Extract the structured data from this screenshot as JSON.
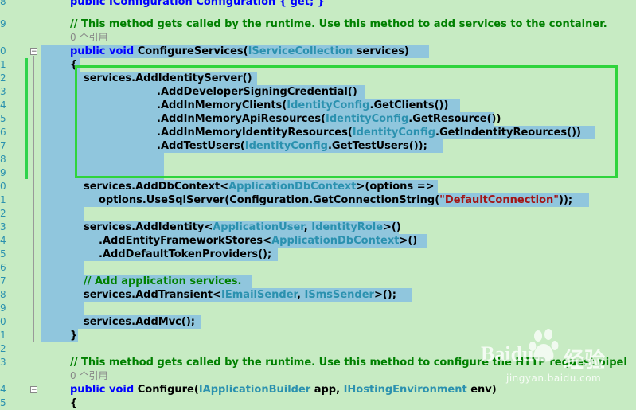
{
  "line_numbers": [
    "8",
    "9",
    "0",
    "1",
    "2",
    "3",
    "4",
    "5",
    "6",
    "7",
    "8",
    "9",
    "0",
    "1",
    "2",
    "3",
    "4",
    "5",
    "6",
    "7",
    "8",
    "9",
    "0",
    "1",
    "2",
    "3",
    "4",
    "5",
    "6"
  ],
  "code": {
    "top_partial": "public IConfiguration Configuration { get; }",
    "comment1": "// This method gets called by the runtime. Use this method to add services to the container.",
    "refs1": "0 个引用",
    "kw_public": "public",
    "kw_void": "void",
    "method1": "ConfigureServices(",
    "type_iservicecollection": "IServiceCollection",
    "param1": " services)",
    "brace_open": "{",
    "brace_close": "}",
    "is1": "services.AddIdentityServer()",
    "is2": ".AddDeveloperSigningCredential()",
    "is3a": ".AddInMemoryClients(",
    "is3t": "IdentityConfig",
    "is3b": ".GetClients())",
    "is4a": ".AddInMemoryApiResources(",
    "is4t": "IdentityConfig",
    "is4b": ".GetResource())",
    "is5a": ".AddInMemoryIdentityResources(",
    "is5t": "IdentityConfig",
    "is5b": ".GetIndentityReources())",
    "is6a": ".AddTestUsers(",
    "is6t": "IdentityConfig",
    "is6b": ".GetTestUsers());",
    "db1a": "services.AddDbContext<",
    "db1t": "ApplicationDbContext",
    "db1b": ">(options =>",
    "db2a": "options.UseSqlServer(Configuration.GetConnectionString(",
    "db2s": "\"DefaultConnection\"",
    "db2b": "));",
    "id1a": "services.AddIdentity<",
    "id1t1": "ApplicationUser",
    "id1c": ", ",
    "id1t2": "IdentityRole",
    "id1b": ">()",
    "id2a": ".AddEntityFrameworkStores<",
    "id2t": "ApplicationDbContext",
    "id2b": ">()",
    "id3": ".AddDefaultTokenProviders();",
    "comment2": "// Add application services.",
    "tr1a": "services.AddTransient<",
    "tr1t1": "IEmailSender",
    "tr1c": ", ",
    "tr1t2": "ISmsSender",
    "tr1b": ">();",
    "mvc": "services.AddMvc();",
    "comment3": "// This method gets called by the runtime. Use this method to configure the HTTP request pipel",
    "refs2": "0 个引用",
    "method2": "Configure(",
    "type_iapp": "IApplicationBuilder",
    "param2a": " app, ",
    "type_ienv": "IHostingEnvironment",
    "param2b": " env)",
    "brace_open2": "{"
  },
  "watermark": {
    "brand": "Baidu",
    "cn": "经验",
    "url": "jingyan.baidu.com"
  },
  "colors": {
    "background": "#c7ebc3",
    "selection": "#90c6dd",
    "keyword": "#0000ff",
    "type": "#2b91af",
    "string": "#a31515",
    "comment": "#008000",
    "highlight_box": "#2fd43c"
  }
}
